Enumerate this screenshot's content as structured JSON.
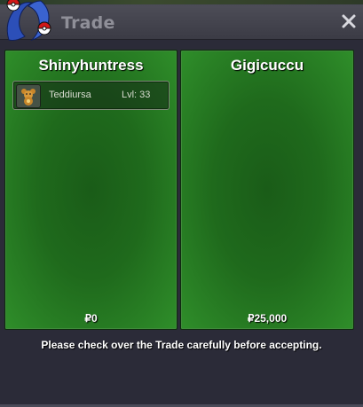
{
  "window": {
    "title": "Trade",
    "close_icon": "close-icon"
  },
  "left_panel": {
    "player_name": "Shinyhuntress",
    "items": [
      {
        "icon": "teddiursa-icon",
        "name": "Teddiursa",
        "level": "Lvl: 33"
      }
    ],
    "money": "₽0"
  },
  "right_panel": {
    "player_name": "Gigicuccu",
    "items": [],
    "money": "₽25,000"
  },
  "notice": "Please check over the Trade carefully before accepting.",
  "colors": {
    "panel_green": "#1f6a1c",
    "titlebar": "#45454f",
    "background": "#2b2b38"
  }
}
